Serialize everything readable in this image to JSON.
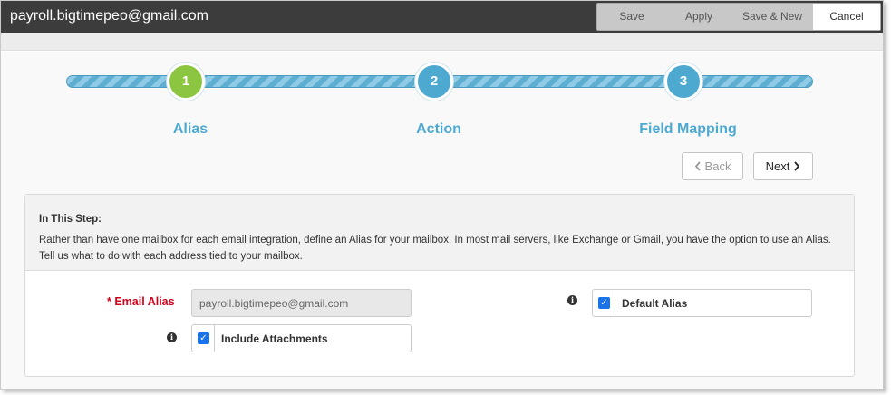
{
  "window": {
    "title": "payroll.bigtimepeo@gmail.com"
  },
  "toolbar": {
    "save_label": "Save",
    "apply_label": "Apply",
    "save_new_label": "Save & New",
    "cancel_label": "Cancel"
  },
  "wizard": {
    "steps": [
      {
        "number": "1",
        "label": "Alias",
        "status": "active",
        "color": "#8cc53f"
      },
      {
        "number": "2",
        "label": "Action",
        "status": "pending",
        "color": "#4ea9d1"
      },
      {
        "number": "3",
        "label": "Field Mapping",
        "status": "pending",
        "color": "#4ea9d1"
      }
    ],
    "back_label": "Back",
    "next_label": "Next"
  },
  "panel": {
    "heading": "In This Step:",
    "description": "Rather than have one mailbox for each email integration, define an Alias for your mailbox. In most mail servers, like Exchange or Gmail, you have the option to use an Alias. Tell us what to do with each address tied to your mailbox."
  },
  "form": {
    "email_alias_label": "* Email Alias",
    "email_alias_value": "payroll.bigtimepeo@gmail.com",
    "default_alias_label": "Default Alias",
    "default_alias_checked": true,
    "include_attachments_label": "Include Attachments",
    "include_attachments_checked": true
  },
  "icons": {
    "info": "info-icon",
    "check": "check-icon",
    "chevron_left": "chevron-left-icon",
    "chevron_right": "chevron-right-icon"
  },
  "colors": {
    "titlebar": "#3c3c3c",
    "accent": "#4ea9d1",
    "active_step": "#8cc53f",
    "required": "#d0021b",
    "checkbox": "#1a73e8"
  }
}
